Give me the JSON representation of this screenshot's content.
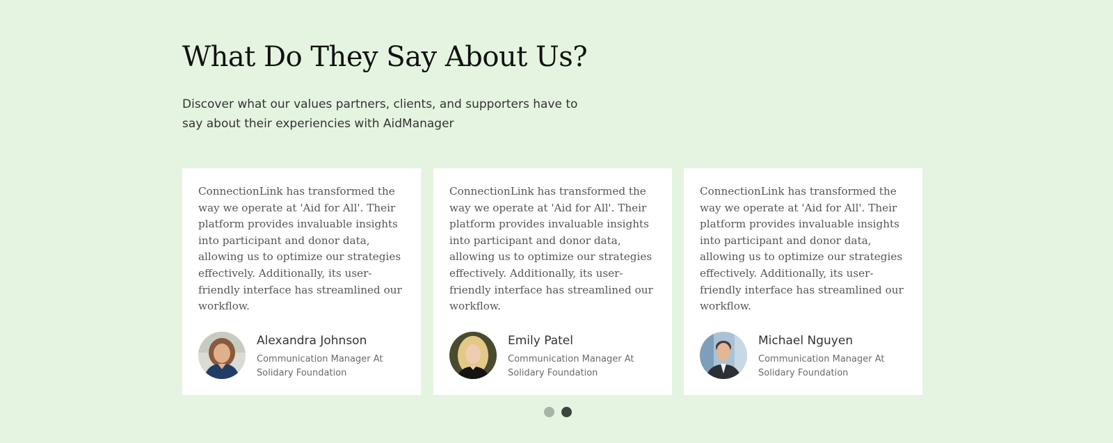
{
  "section": {
    "title": "What Do They Say About Us?",
    "subtitle": "Discover what our values partners, clients, and supporters have to say about their experiencies with AidManager"
  },
  "testimonials": [
    {
      "quote": "ConnectionLink has transformed the way we operate at 'Aid for All'. Their platform provides invaluable insights into participant and donor data, allowing us to optimize our strategies effectively. Additionally, its user-friendly interface has streamlined our workflow.",
      "name": "Alexandra Johnson",
      "role": "Communication Manager At Solidary Foundation",
      "avatar_icon": "avatar-photo"
    },
    {
      "quote": "ConnectionLink has transformed the way we operate at 'Aid for All'. Their platform provides invaluable insights into participant and donor data, allowing us to optimize our strategies effectively. Additionally, its user-friendly interface has streamlined our workflow.",
      "name": "Emily Patel",
      "role": "Communication Manager At Solidary Foundation",
      "avatar_icon": "avatar-photo"
    },
    {
      "quote": "ConnectionLink has transformed the way we operate at 'Aid for All'. Their platform provides invaluable insights into participant and donor data, allowing us to optimize our strategies effectively. Additionally, its user-friendly interface has streamlined our workflow.",
      "name": "Michael Nguyen",
      "role": "Communication Manager At Solidary Foundation",
      "avatar_icon": "avatar-photo"
    }
  ],
  "carousel": {
    "pages": 2,
    "active_page": 2
  },
  "colors": {
    "background": "#e5f4e0",
    "card": "#ffffff",
    "dot_inactive": "#a9b3a8",
    "dot_active": "#3c443c"
  }
}
